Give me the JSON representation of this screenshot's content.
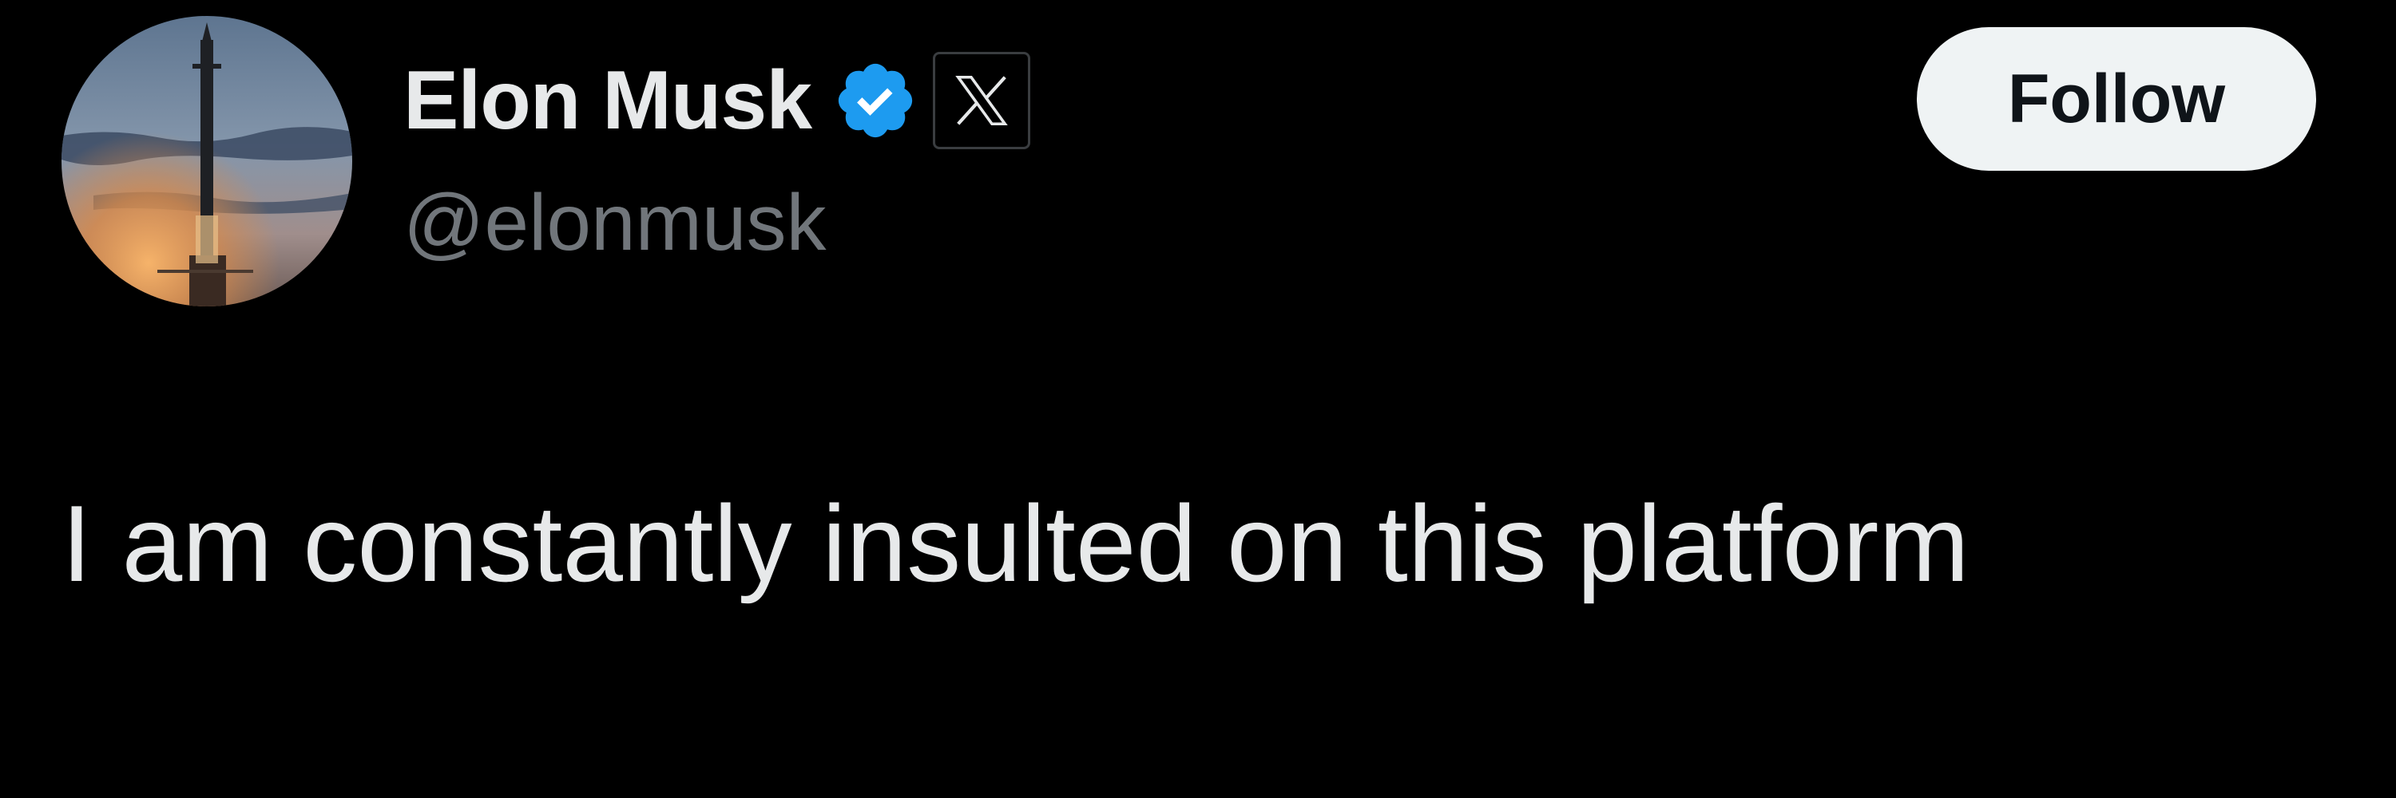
{
  "author": {
    "display_name": "Elon Musk",
    "handle": "@elonmusk",
    "verified": true,
    "verified_color": "#1d9bf0",
    "affiliate_badge": "x-logo-icon",
    "avatar": "starship-launch-avatar"
  },
  "actions": {
    "follow_label": "Follow"
  },
  "tweet": {
    "text": "I am constantly insulted on this platform"
  },
  "theme": {
    "background": "#000000",
    "text_primary": "#e7e9ea",
    "text_secondary": "#71767b",
    "button_bg": "#eff3f4"
  }
}
